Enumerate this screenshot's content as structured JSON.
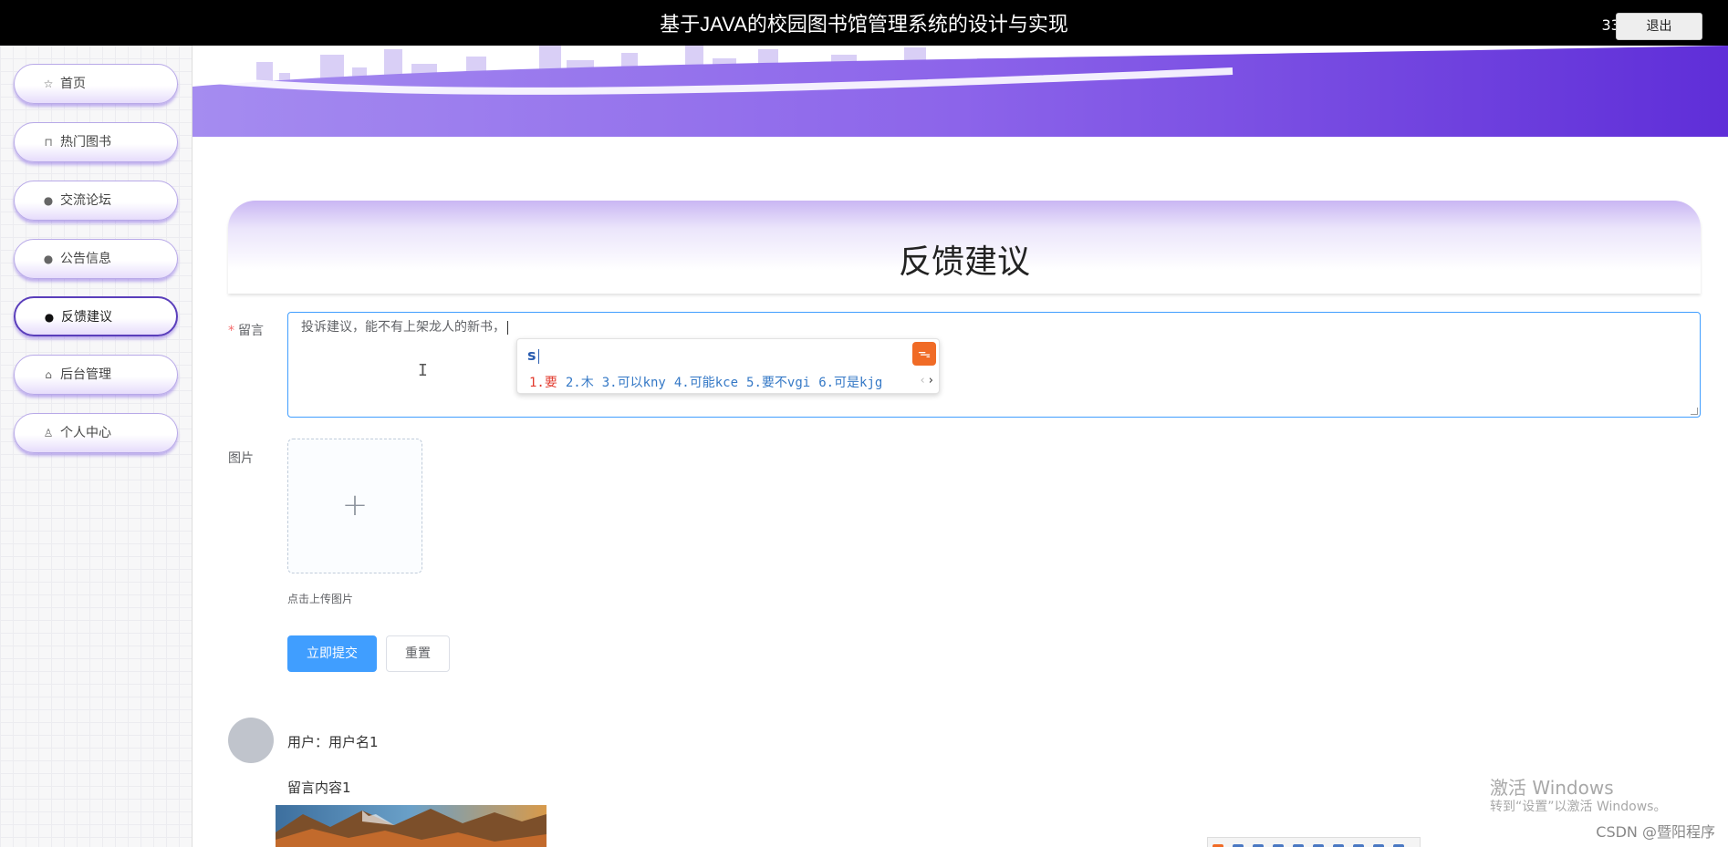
{
  "header": {
    "title": "基于JAVA的校园图书馆管理系统的设计与实现",
    "user": "333",
    "logout_label": "退出"
  },
  "sidebar": {
    "items": [
      {
        "label": "首页",
        "icon": "star-icon"
      },
      {
        "label": "热门图书",
        "icon": "bag-icon"
      },
      {
        "label": "交流论坛",
        "icon": "exclamation-circle-icon"
      },
      {
        "label": "公告信息",
        "icon": "question-circle-icon"
      },
      {
        "label": "反馈建议",
        "icon": "info-circle-icon",
        "active": true
      },
      {
        "label": "后台管理",
        "icon": "store-icon"
      },
      {
        "label": "个人中心",
        "icon": "user-icon"
      }
    ]
  },
  "page": {
    "title": "反馈建议"
  },
  "form": {
    "message_label": "留言",
    "message_value": "投诉建议，能不有上架龙人的新书，",
    "image_label": "图片",
    "upload_hint": "点击上传图片",
    "submit_label": "立即提交",
    "reset_label": "重置"
  },
  "ime": {
    "composition": "s",
    "candidates": [
      "1.要",
      "2.木",
      "3.可以kny",
      "4.可能kce",
      "5.要不vgi",
      "6.可是kjg"
    ]
  },
  "comment": {
    "user_text": "用户：用户名1",
    "content": "留言内容1"
  },
  "watermark": {
    "line1": "激活 Windows",
    "line2": "转到“设置”以激活 Windows。",
    "csdn": "CSDN @暨阳程序"
  },
  "colors": {
    "accent_purple": "#7b52e6",
    "primary_button": "#409eff",
    "header_bg": "#000000"
  }
}
